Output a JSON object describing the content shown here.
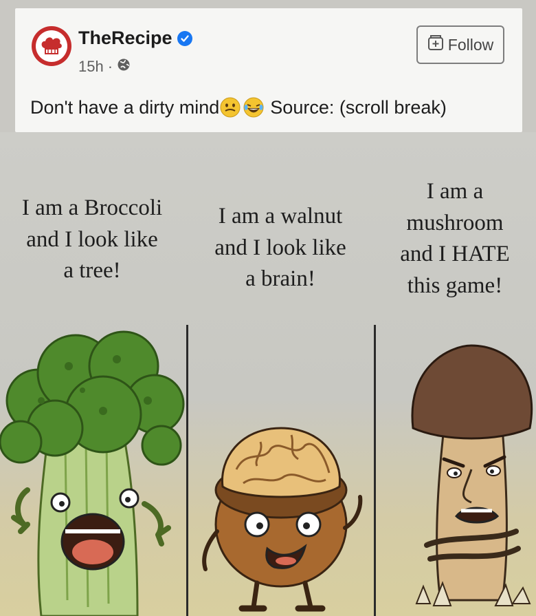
{
  "post": {
    "page_name": "TheRecipe",
    "time": "15h",
    "separator": "·",
    "follow_label": "Follow",
    "caption_text": "Don't have a dirty mind",
    "caption_source": "Source: (scroll break)"
  },
  "comic": {
    "panels": [
      {
        "lines": [
          "I am a Broccoli",
          "and I look like",
          "a tree!"
        ]
      },
      {
        "lines": [
          "I am a walnut",
          "and I look like",
          "a brain!"
        ]
      },
      {
        "lines": [
          "I am a",
          "mushroom",
          "and I HATE",
          "this game!"
        ]
      }
    ]
  },
  "colors": {
    "avatar_red": "#c62d2d",
    "verified_blue": "#1877f2",
    "broccoli_green": "#4f8a2c",
    "walnut_brown": "#a8692f",
    "mushroom_cap": "#6e4a35"
  },
  "icons": [
    "chef-hat-icon",
    "verified-badge-icon",
    "globe-icon",
    "add-page-icon",
    "grimace-emoji-icon",
    "laughing-emoji-icon"
  ]
}
